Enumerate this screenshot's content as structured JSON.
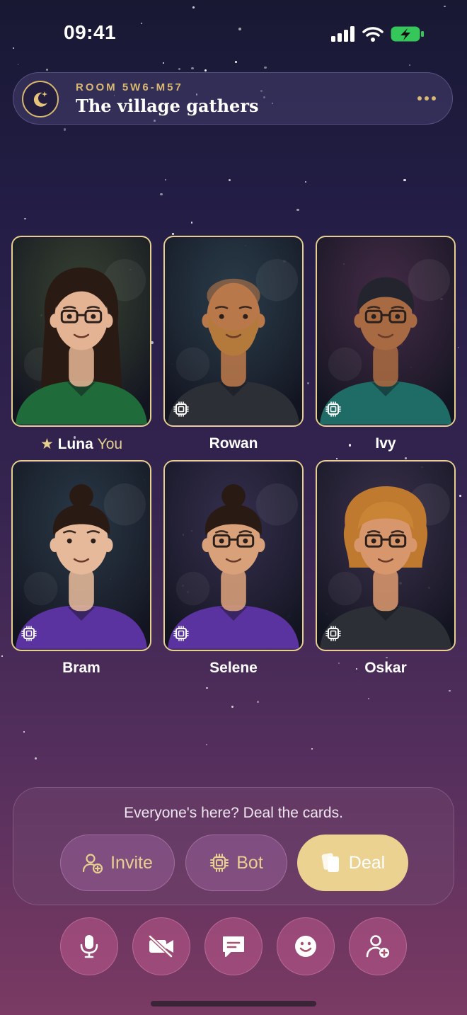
{
  "status_bar": {
    "time": "09:41"
  },
  "room": {
    "code": "ROOM 5W6-M57",
    "title": "The village gathers",
    "icon": "moon-stars-icon"
  },
  "players": [
    {
      "name": "Luna",
      "you_label": "You",
      "is_host": true,
      "is_bot": false,
      "hair": "long",
      "shirt": "#1f6b3a",
      "skin": "#e3b393",
      "bg": "#3a4a2a",
      "glasses": true
    },
    {
      "name": "Rowan",
      "is_bot": true,
      "hair": "bald-beard",
      "shirt": "#2c2f35",
      "skin": "#b9784a",
      "bg": "#2a4348",
      "glasses": false
    },
    {
      "name": "Ivy",
      "is_bot": true,
      "hair": "short",
      "shirt": "#1f6b66",
      "skin": "#a86a42",
      "bg": "#4a2e44",
      "glasses": true
    },
    {
      "name": "Bram",
      "is_bot": true,
      "hair": "bun",
      "shirt": "#5b33a0",
      "skin": "#e6b99a",
      "bg": "#243c40",
      "glasses": false
    },
    {
      "name": "Selene",
      "is_bot": true,
      "hair": "bun",
      "shirt": "#5b33a0",
      "skin": "#d9a17a",
      "bg": "#33304a",
      "glasses": true
    },
    {
      "name": "Oskar",
      "is_bot": true,
      "hair": "curly",
      "shirt": "#2c2f35",
      "skin": "#d8966c",
      "bg": "#3a3348",
      "glasses": true
    }
  ],
  "action_panel": {
    "prompt": "Everyone's here? Deal the cards.",
    "invite_label": "Invite",
    "bot_label": "Bot",
    "deal_label": "Deal"
  },
  "controls": [
    "microphone-icon",
    "camera-off-icon",
    "chat-icon",
    "emoji-icon",
    "add-user-icon"
  ],
  "colors": {
    "accent_gold": "#e6cf8f",
    "deal_button": "#ecd290"
  }
}
